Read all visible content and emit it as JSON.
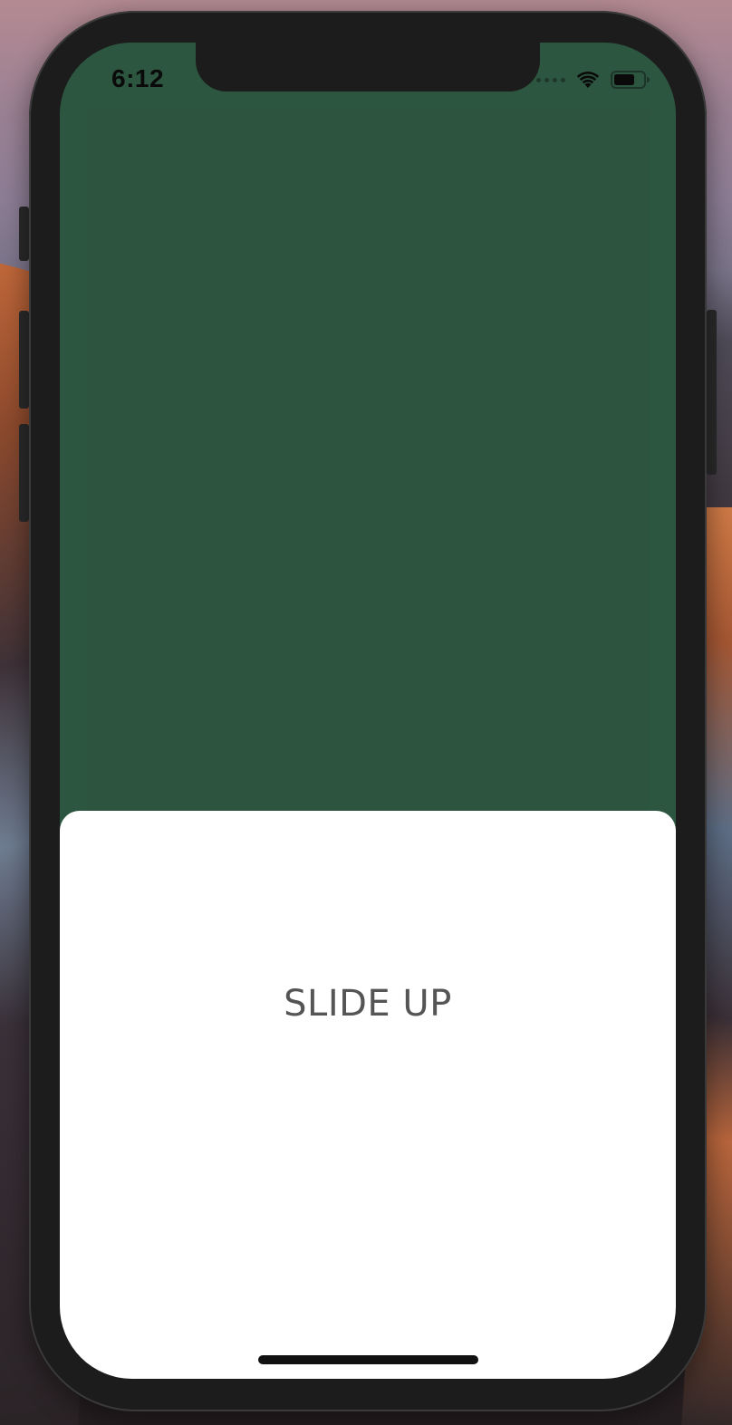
{
  "status_bar": {
    "time": "6:12",
    "signal_icon": "signal-dots-icon",
    "wifi_icon": "wifi-icon",
    "battery_icon": "battery-icon"
  },
  "main": {
    "background_color": "#2d5640"
  },
  "slide_panel": {
    "label": "SLIDE UP",
    "background_color": "#ffffff",
    "text_color": "#555555"
  }
}
